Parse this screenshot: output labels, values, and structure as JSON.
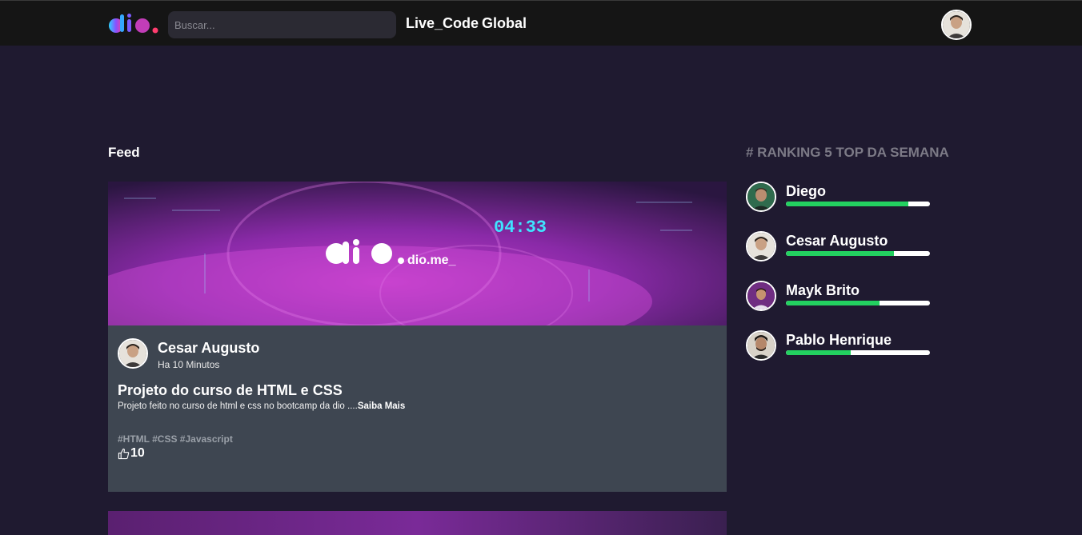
{
  "header": {
    "logo": "dio.",
    "search_placeholder": "Buscar...",
    "nav": [
      "Live_Code",
      "Global"
    ]
  },
  "feed": {
    "title": "Feed",
    "post": {
      "banner_text": "dio.me_",
      "banner_time": "04:33",
      "author": "Cesar Augusto",
      "time": "Ha 10 Minutos",
      "title": "Projeto do curso de HTML e CSS",
      "description": "Projeto feito no curso de html e css no bootcamp da dio ....",
      "more": "Saiba Mais",
      "tags": "#HTML #CSS #Javascript",
      "likes": "10"
    }
  },
  "ranking": {
    "title": "# RANKING 5 TOP DA SEMANA",
    "users": [
      {
        "name": "Diego",
        "progress": 0.85
      },
      {
        "name": "Cesar Augusto",
        "progress": 0.75
      },
      {
        "name": "Mayk Brito",
        "progress": 0.65
      },
      {
        "name": "Pablo Henrique",
        "progress": 0.45
      }
    ]
  },
  "colors": {
    "background": "#1f1a30",
    "topbar": "#151515",
    "card": "#3e4651",
    "progress": "#23d160",
    "ranking_title": "#7c7a86"
  }
}
